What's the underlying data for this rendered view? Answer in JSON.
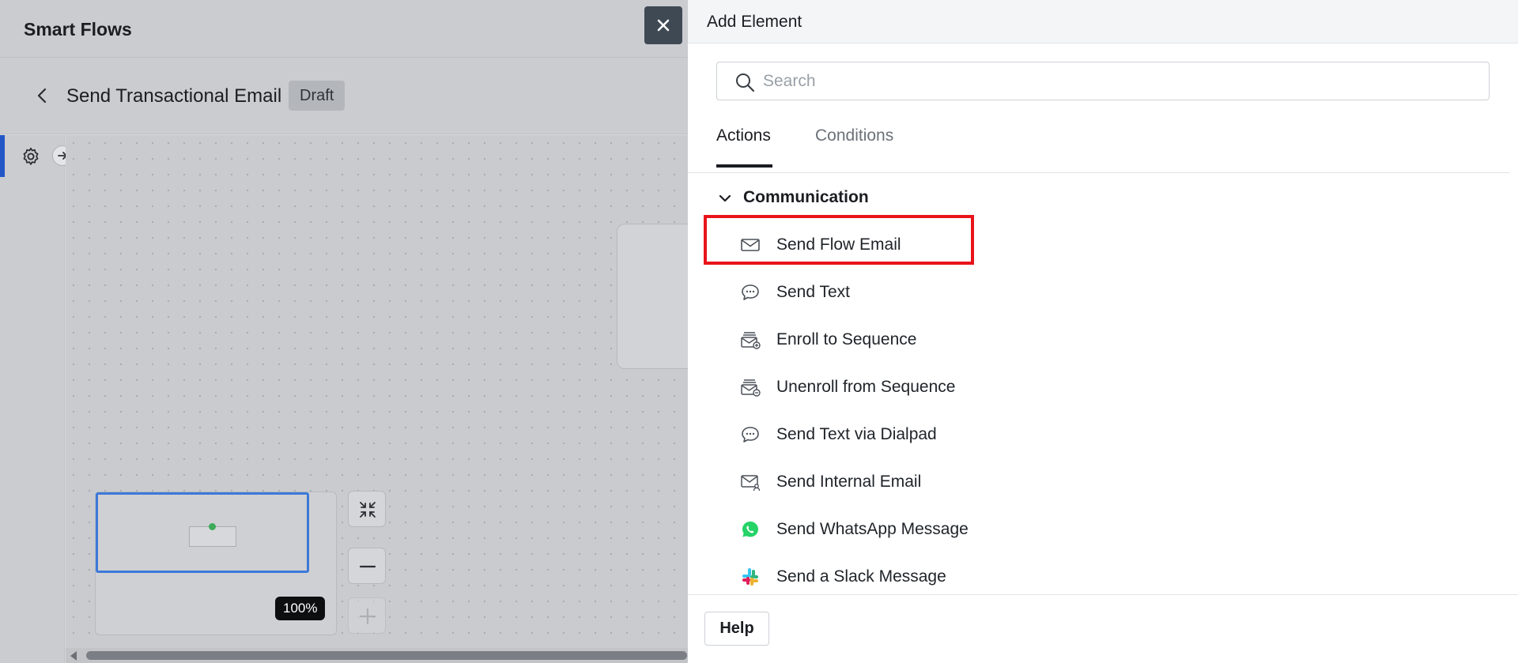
{
  "app": {
    "title": "Smart Flows",
    "flow_name": "Send Transactional Email",
    "status_badge": "Draft",
    "zoom_level": "100%"
  },
  "panel": {
    "title": "Add Element",
    "search": {
      "value": "",
      "placeholder": "Search"
    },
    "tabs": [
      {
        "label": "Actions",
        "active": true
      },
      {
        "label": "Conditions",
        "active": false
      }
    ],
    "section": {
      "title": "Communication",
      "expanded": true
    },
    "items": [
      {
        "label": "Send Flow Email",
        "icon": "envelope-icon",
        "highlighted": true
      },
      {
        "label": "Send Text",
        "icon": "chat-bubble-icon"
      },
      {
        "label": "Enroll to Sequence",
        "icon": "sequence-add-icon"
      },
      {
        "label": "Unenroll from Sequence",
        "icon": "sequence-remove-icon"
      },
      {
        "label": "Send Text via Dialpad",
        "icon": "chat-bubble-icon"
      },
      {
        "label": "Send Internal Email",
        "icon": "envelope-user-icon"
      },
      {
        "label": "Send WhatsApp Message",
        "icon": "whatsapp-icon"
      },
      {
        "label": "Send a Slack Message",
        "icon": "slack-icon"
      }
    ],
    "help_label": "Help"
  },
  "colors": {
    "accent": "#2357c8",
    "highlight": "#e8141a",
    "whatsapp": "#25d366"
  }
}
